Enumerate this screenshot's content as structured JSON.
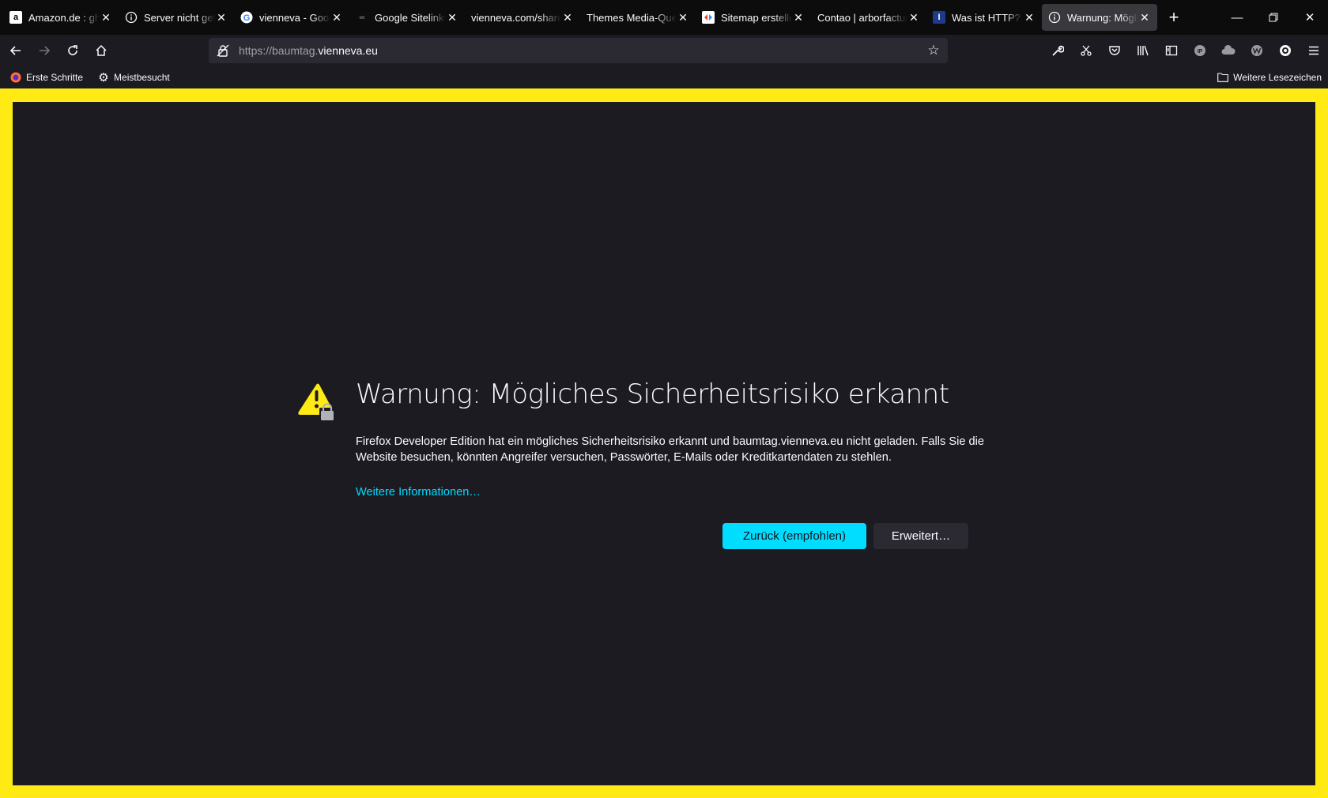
{
  "tabs": [
    {
      "title": "Amazon.de : gh",
      "favicon": "amazon-icon"
    },
    {
      "title": "Server nicht gefu",
      "favicon": "info-icon"
    },
    {
      "title": "vienneva - Googl",
      "favicon": "google-icon"
    },
    {
      "title": "Google Sitelinks",
      "favicon": "link-icon"
    },
    {
      "title": "vienneva.com/share/",
      "favicon": "blank-icon"
    },
    {
      "title": "Themes Media-Quer",
      "favicon": "blank-icon"
    },
    {
      "title": "Sitemap erstellen",
      "favicon": "sitemap-icon"
    },
    {
      "title": "Contao | arborfactum",
      "favicon": "blank-icon"
    },
    {
      "title": "Was ist HTTP? Da",
      "favicon": "i-icon"
    },
    {
      "title": "Warnung: Möglic",
      "favicon": "info-icon"
    }
  ],
  "urlbar": {
    "url_dim": "https://baumtag.",
    "url_main": "vienneva.eu"
  },
  "bookmarks": {
    "first": "Erste Schritte",
    "second": "Meistbesucht",
    "other": "Weitere Lesezeichen"
  },
  "error": {
    "title": "Warnung: Mögliches Sicherheitsrisiko erkannt",
    "description": "Firefox Developer Edition hat ein mögliches Sicherheitsrisiko erkannt und baumtag.vienneva.eu nicht geladen. Falls Sie die Website besuchen, könnten Angreifer versuchen, Passwörter, E-Mails oder Kreditkartendaten zu stehlen.",
    "link": "Weitere Informationen…",
    "back_button": "Zurück (empfohlen)",
    "advanced_button": "Erweitert…"
  },
  "colors": {
    "frame": "#ffea14",
    "accent": "#00ddff",
    "background": "#1c1b22"
  }
}
